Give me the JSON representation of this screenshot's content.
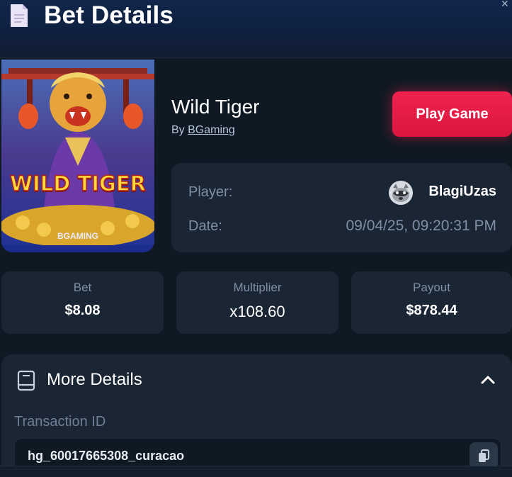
{
  "header": {
    "title": "Bet Details",
    "doc_icon": "document-icon",
    "close_icon": "close-icon"
  },
  "game": {
    "thumbnail_title": "WILD TIGER",
    "thumbnail_brand": "BGAMING",
    "name": "Wild Tiger",
    "by_prefix": "By",
    "provider": "BGaming",
    "play_button": "Play Game"
  },
  "info": {
    "player_label": "Player:",
    "player_name": "BlagiUzas",
    "date_label": "Date:",
    "date_value": "09/04/25, 09:20:31 PM"
  },
  "stats": [
    {
      "label": "Bet",
      "value": "$8.08"
    },
    {
      "label": "Multiplier",
      "value": "x108.60"
    },
    {
      "label": "Payout",
      "value": "$878.44"
    }
  ],
  "more_details": {
    "title": "More Details",
    "transaction_label": "Transaction ID",
    "transaction_id": "hg_60017665308_curacao"
  },
  "colors": {
    "background": "#0f1923",
    "card": "#1a2634",
    "accent_red": "#e91e4b",
    "muted_text": "#7f8fa6"
  }
}
